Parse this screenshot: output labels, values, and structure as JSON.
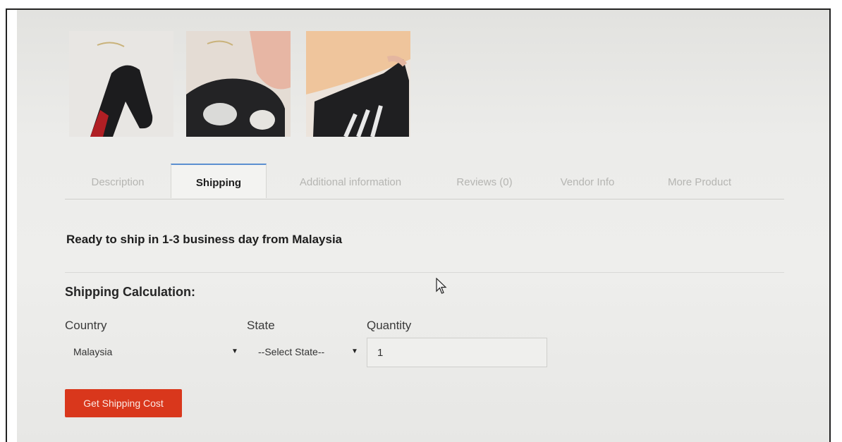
{
  "tabs": [
    {
      "label": "Description",
      "active": false
    },
    {
      "label": "Shipping",
      "active": true
    },
    {
      "label": "Additional information",
      "active": false
    },
    {
      "label": "Reviews (0)",
      "active": false
    },
    {
      "label": "Vendor Info",
      "active": false
    },
    {
      "label": "More Product",
      "active": false
    }
  ],
  "shipping": {
    "ready_text": "Ready to ship in 1-3 business day from Malaysia",
    "calc_title": "Shipping Calculation:",
    "country_label": "Country",
    "country_value": "Malaysia",
    "state_label": "State",
    "state_value": "--Select State--",
    "quantity_label": "Quantity",
    "quantity_value": "1",
    "button_label": "Get Shipping Cost"
  },
  "colors": {
    "accent_button": "#d9371c",
    "active_tab_border": "#5b8fd0"
  },
  "icons": {
    "select_arrow": "triangle-down-icon",
    "cursor": "mouse-pointer-icon"
  }
}
